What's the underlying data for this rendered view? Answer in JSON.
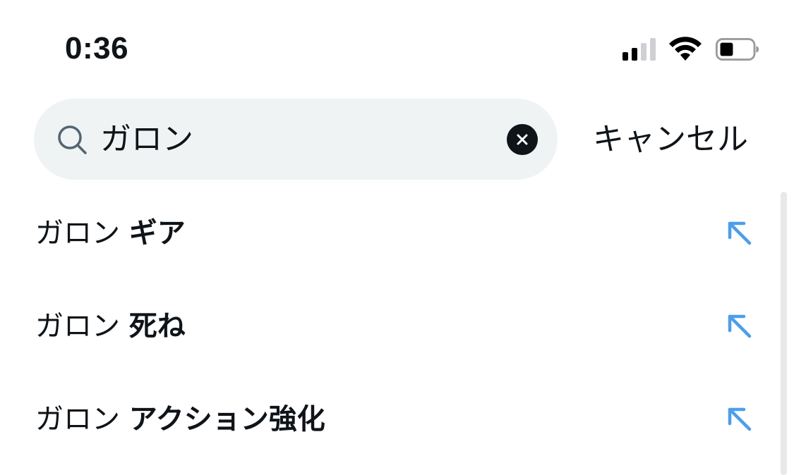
{
  "status_bar": {
    "time": "0:36",
    "icons": [
      "signal-icon",
      "wifi-icon",
      "battery-icon"
    ]
  },
  "search": {
    "query": "ガロン",
    "icon": "search-icon",
    "clear_icon": "clear-icon",
    "field_bg": "#eff3f4"
  },
  "cancel_label": "キャンセル",
  "suggestions": [
    {
      "query": "ガロン",
      "completion": "ギア"
    },
    {
      "query": "ガロン",
      "completion": "死ね"
    },
    {
      "query": "ガロン",
      "completion": "アクション強化"
    }
  ],
  "colors": {
    "accent": "#4c9eeb",
    "text": "#0f1419"
  }
}
